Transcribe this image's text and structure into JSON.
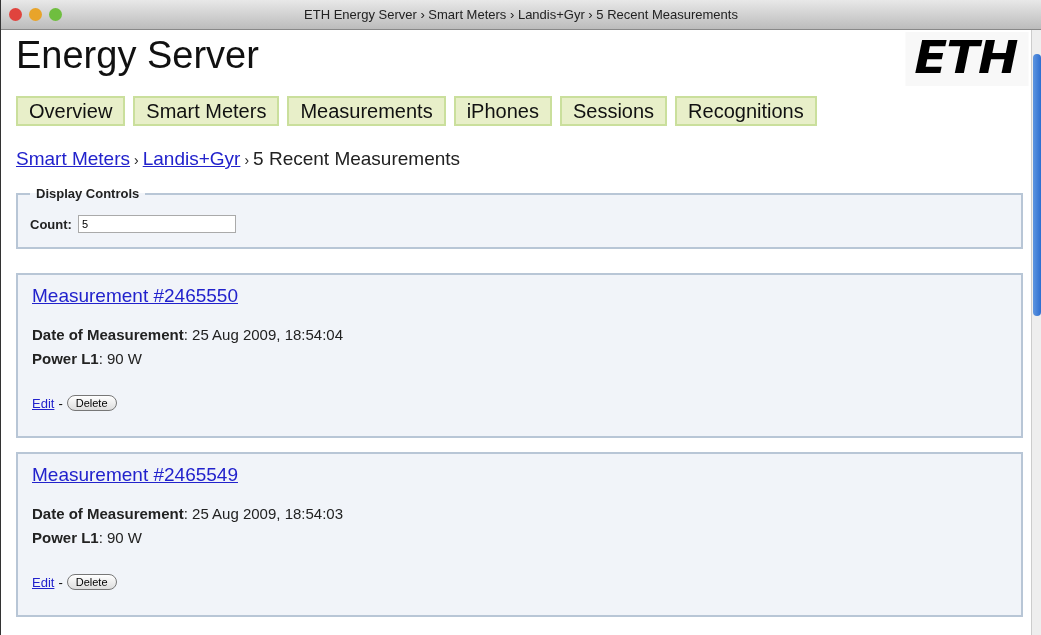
{
  "window": {
    "title": "ETH Energy Server › Smart Meters › Landis+Gyr › 5 Recent Measurements"
  },
  "header": {
    "title": "Energy Server",
    "logo": "ETH"
  },
  "tabs": [
    {
      "label": "Overview"
    },
    {
      "label": "Smart Meters"
    },
    {
      "label": "Measurements"
    },
    {
      "label": "iPhones"
    },
    {
      "label": "Sessions"
    },
    {
      "label": "Recognitions"
    }
  ],
  "breadcrumb": [
    {
      "kind": "link",
      "text": "Smart Meters"
    },
    {
      "kind": "sep",
      "text": "›"
    },
    {
      "kind": "link",
      "text": "Landis+Gyr"
    },
    {
      "kind": "sep",
      "text": "›"
    },
    {
      "kind": "current",
      "text": "5 Recent Measurements"
    }
  ],
  "display_controls": {
    "legend": "Display Controls",
    "label": "Count:",
    "value": "5"
  },
  "measurements": [
    {
      "title": "Measurement #2465550",
      "fields": [
        "**Date of Measurement**: 25 Aug 2009, 18:54:04",
        "**Power L1**: 90 W"
      ],
      "edit": "Edit",
      "separator": "-",
      "delete": "Delete"
    },
    {
      "title": "Measurement #2465549",
      "fields": [
        "**Date of Measurement**: 25 Aug 2009, 18:54:03",
        "**Power L1**: 90 W"
      ],
      "edit": "Edit",
      "separator": "-",
      "delete": "Delete"
    }
  ]
}
